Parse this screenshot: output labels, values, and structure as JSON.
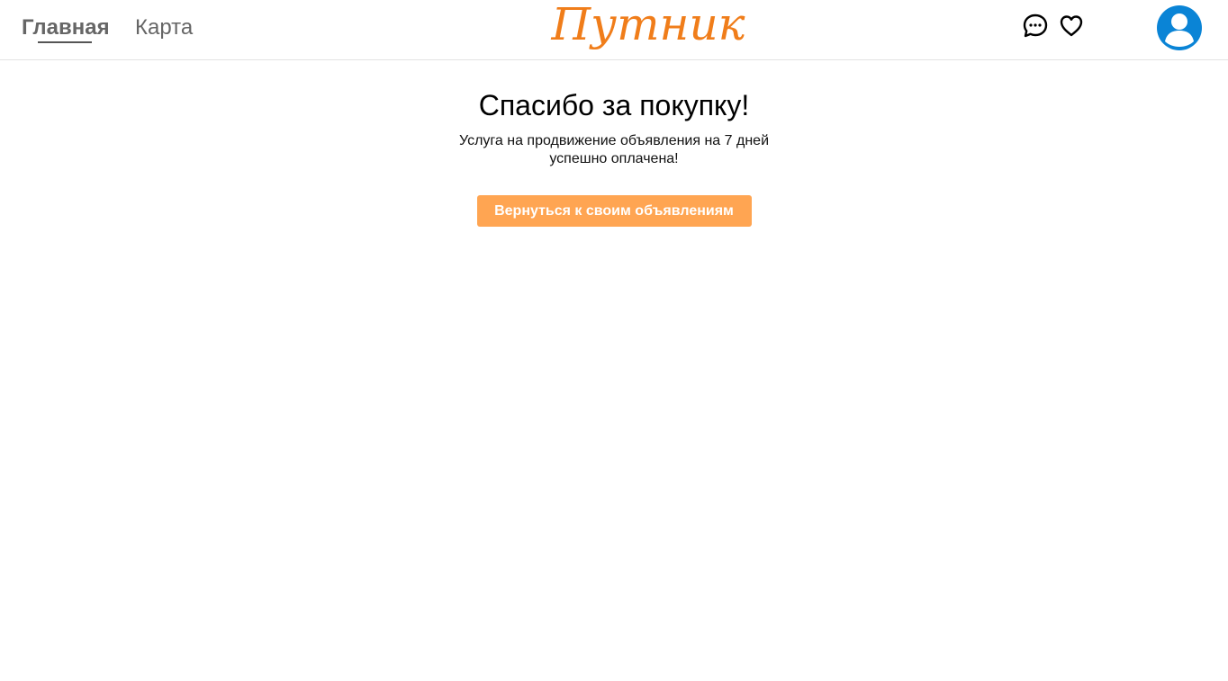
{
  "header": {
    "nav": {
      "home_label": "Главная",
      "map_label": "Карта"
    },
    "logo_text": "Путник",
    "icons": {
      "chat": "chat-bubble-icon",
      "favorites": "heart-icon",
      "profile": "user-avatar-icon"
    }
  },
  "main": {
    "title": "Спасибо за покупку!",
    "message": "Услуга на продвижение объявления на 7 дней успешно оплачена!",
    "button_label": "Вернуться к своим объявлениям"
  },
  "colors": {
    "accent": "#ffa552",
    "logo": "#f07d1a",
    "avatar": "#0a84d6",
    "nav_text": "#666666"
  }
}
